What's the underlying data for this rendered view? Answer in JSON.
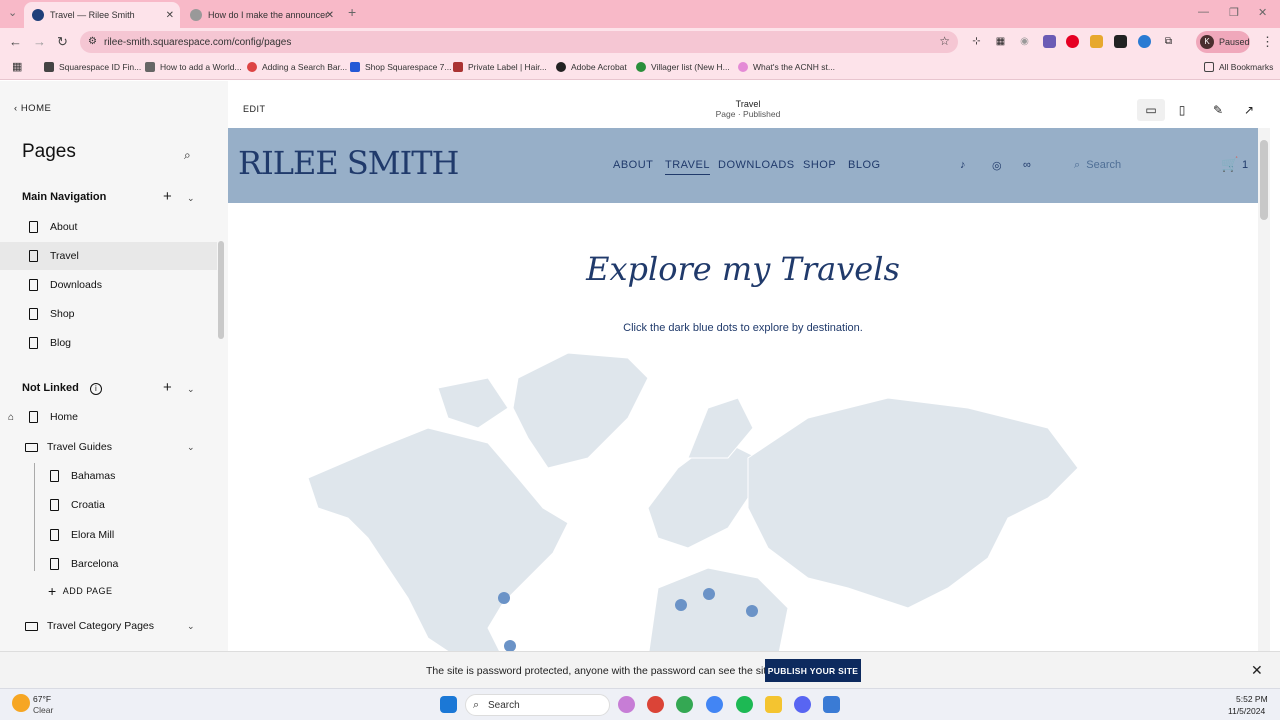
{
  "browser": {
    "tabs": [
      {
        "label": "Travel — Rilee Smith",
        "active": true
      },
      {
        "label": "How do I make the announcem",
        "active": false
      }
    ],
    "url": "rilee-smith.squarespace.com/config/pages",
    "profile_initial": "K",
    "profile_status": "Paused",
    "bookmarks": [
      "Squarespace ID Fin...",
      "How to add a World...",
      "Adding a Search Bar...",
      "Shop Squarespace 7...",
      "Private Label | Hair...",
      "Adobe Acrobat",
      "Villager list (New H...",
      "What's the ACNH st..."
    ],
    "all_bookmarks": "All Bookmarks"
  },
  "sidebar": {
    "back_label": "HOME",
    "title": "Pages",
    "main_navigation": {
      "label": "Main Navigation",
      "items": [
        "About",
        "Travel",
        "Downloads",
        "Shop",
        "Blog"
      ],
      "selected": "Travel"
    },
    "not_linked": {
      "label": "Not Linked",
      "home": "Home",
      "folder": "Travel Guides",
      "folder_items": [
        "Bahamas",
        "Croatia",
        "Elora Mill",
        "Barcelona"
      ],
      "add_page": "ADD PAGE",
      "folder2": "Travel Category Pages"
    }
  },
  "editor": {
    "edit_label": "EDIT",
    "page_name": "Travel",
    "page_status": "Page · Published"
  },
  "site": {
    "logo": "RILEE SMITH",
    "nav": [
      "ABOUT",
      "TRAVEL",
      "DOWNLOADS",
      "SHOP",
      "BLOG"
    ],
    "active_nav": "TRAVEL",
    "search_placeholder": "Search",
    "cart_count": "1",
    "heading": "Explore my Travels",
    "subheading": "Click the dark blue dots to explore by destination.",
    "colors": {
      "header_bg": "#97afc8",
      "brand": "#203a6b",
      "map_land": "#dfe6ec",
      "dot": "#6b93c7"
    }
  },
  "banner": {
    "text": "The site is password protected, anyone with the password can see the site.",
    "button": "PUBLISH YOUR SITE"
  },
  "taskbar": {
    "weather_temp": "67°F",
    "weather_desc": "Clear",
    "search_label": "Search",
    "time": "5:52 PM",
    "date": "11/5/2024"
  }
}
